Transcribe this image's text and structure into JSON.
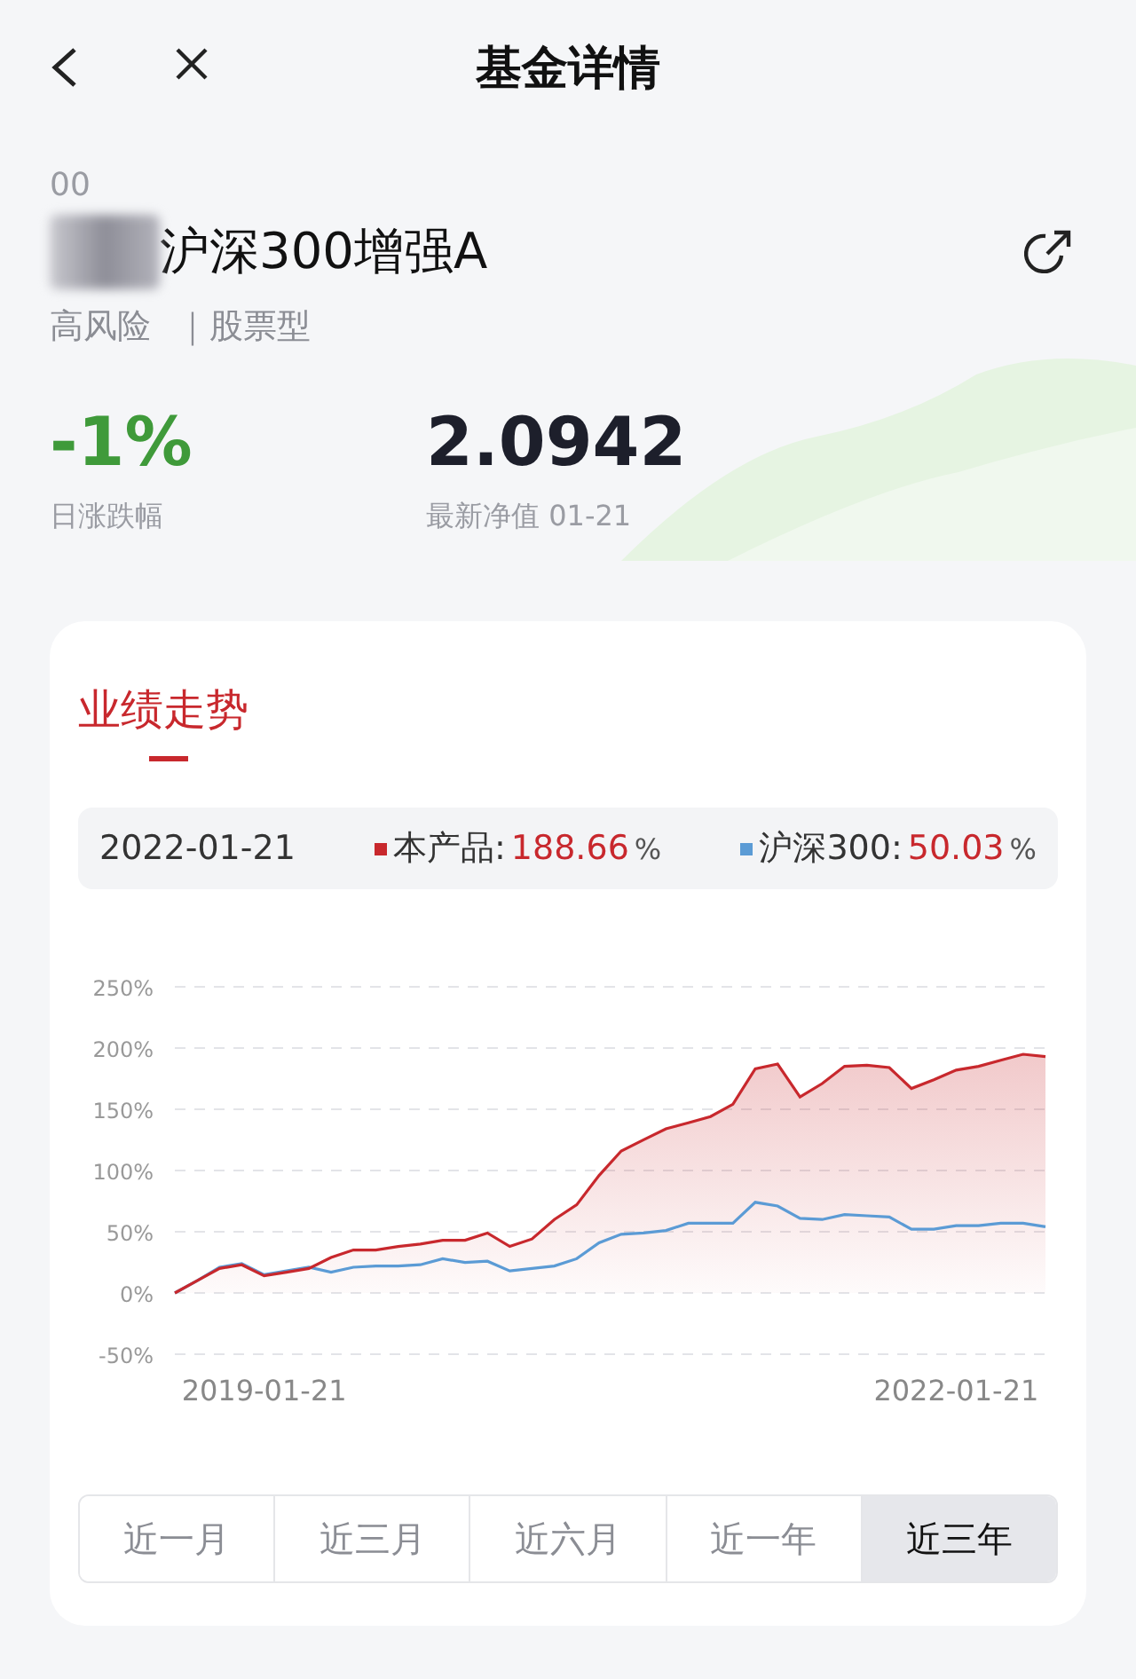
{
  "header": {
    "title": "基金详情"
  },
  "fund": {
    "code": "00",
    "name": "沪深300增强A",
    "risk": "高风险",
    "type": "｜股票型"
  },
  "stats": [
    {
      "kind": "change",
      "value": "-1%",
      "label": "日涨跌幅"
    },
    {
      "kind": "nav",
      "value": "2.0942",
      "label": "最新净值 01-21"
    }
  ],
  "performance": {
    "title": "业绩走势",
    "legend": {
      "date": "2022-01-21",
      "separator": ":",
      "items": [
        {
          "value": "188.66",
          "unit": "%"
        },
        {
          "value": "50.03",
          "unit": "%"
        }
      ]
    },
    "chart_data": {
      "type": "line",
      "categories": [
        null,
        null,
        null,
        null,
        "2019-01-21",
        null,
        null,
        null,
        null,
        null,
        null,
        null,
        null,
        null,
        null,
        null,
        null,
        null,
        null,
        null,
        null,
        null,
        null,
        null,
        null,
        null,
        null,
        null,
        null,
        null,
        null,
        null,
        null,
        null,
        null,
        "2022-01-21",
        null,
        null,
        null,
        null
      ],
      "series": [
        {
          "name": "本产品",
          "type": "area",
          "color": "#c8282d",
          "values": [
            0,
            10,
            20,
            23,
            14,
            17,
            20,
            29,
            35,
            35,
            38,
            40,
            43,
            43,
            49,
            38,
            44,
            60,
            72,
            96,
            116,
            125,
            134,
            139,
            144,
            154,
            183,
            187,
            160,
            171,
            185,
            186,
            184,
            167,
            174,
            182,
            185,
            190,
            195,
            193
          ]
        },
        {
          "name": "沪深300",
          "type": "line",
          "color": "#5b9bd5",
          "values": [
            0,
            10,
            21,
            24,
            15,
            18,
            21,
            17,
            21,
            22,
            22,
            23,
            28,
            25,
            26,
            18,
            20,
            22,
            28,
            41,
            48,
            49,
            51,
            57,
            57,
            57,
            74,
            71,
            61,
            60,
            64,
            63,
            62,
            52,
            52,
            55,
            55,
            57,
            57,
            54
          ]
        }
      ],
      "grid": true,
      "ylim": [
        -50,
        250
      ],
      "yticks": [
        {
          "value": 250,
          "label": "250%"
        },
        {
          "value": 200,
          "label": "200%"
        },
        {
          "value": 150,
          "label": "150%"
        },
        {
          "value": 100,
          "label": "100%"
        },
        {
          "value": 50,
          "label": "50%"
        },
        {
          "value": 0,
          "label": "0%"
        },
        {
          "value": -50,
          "label": "-50%"
        }
      ],
      "xlabel": null
    },
    "periods": [
      {
        "label": "近一月",
        "selected": false
      },
      {
        "label": "近三月",
        "selected": false
      },
      {
        "label": "近六月",
        "selected": false
      },
      {
        "label": "近一年",
        "selected": false
      },
      {
        "label": "近三年",
        "selected": true
      }
    ]
  }
}
